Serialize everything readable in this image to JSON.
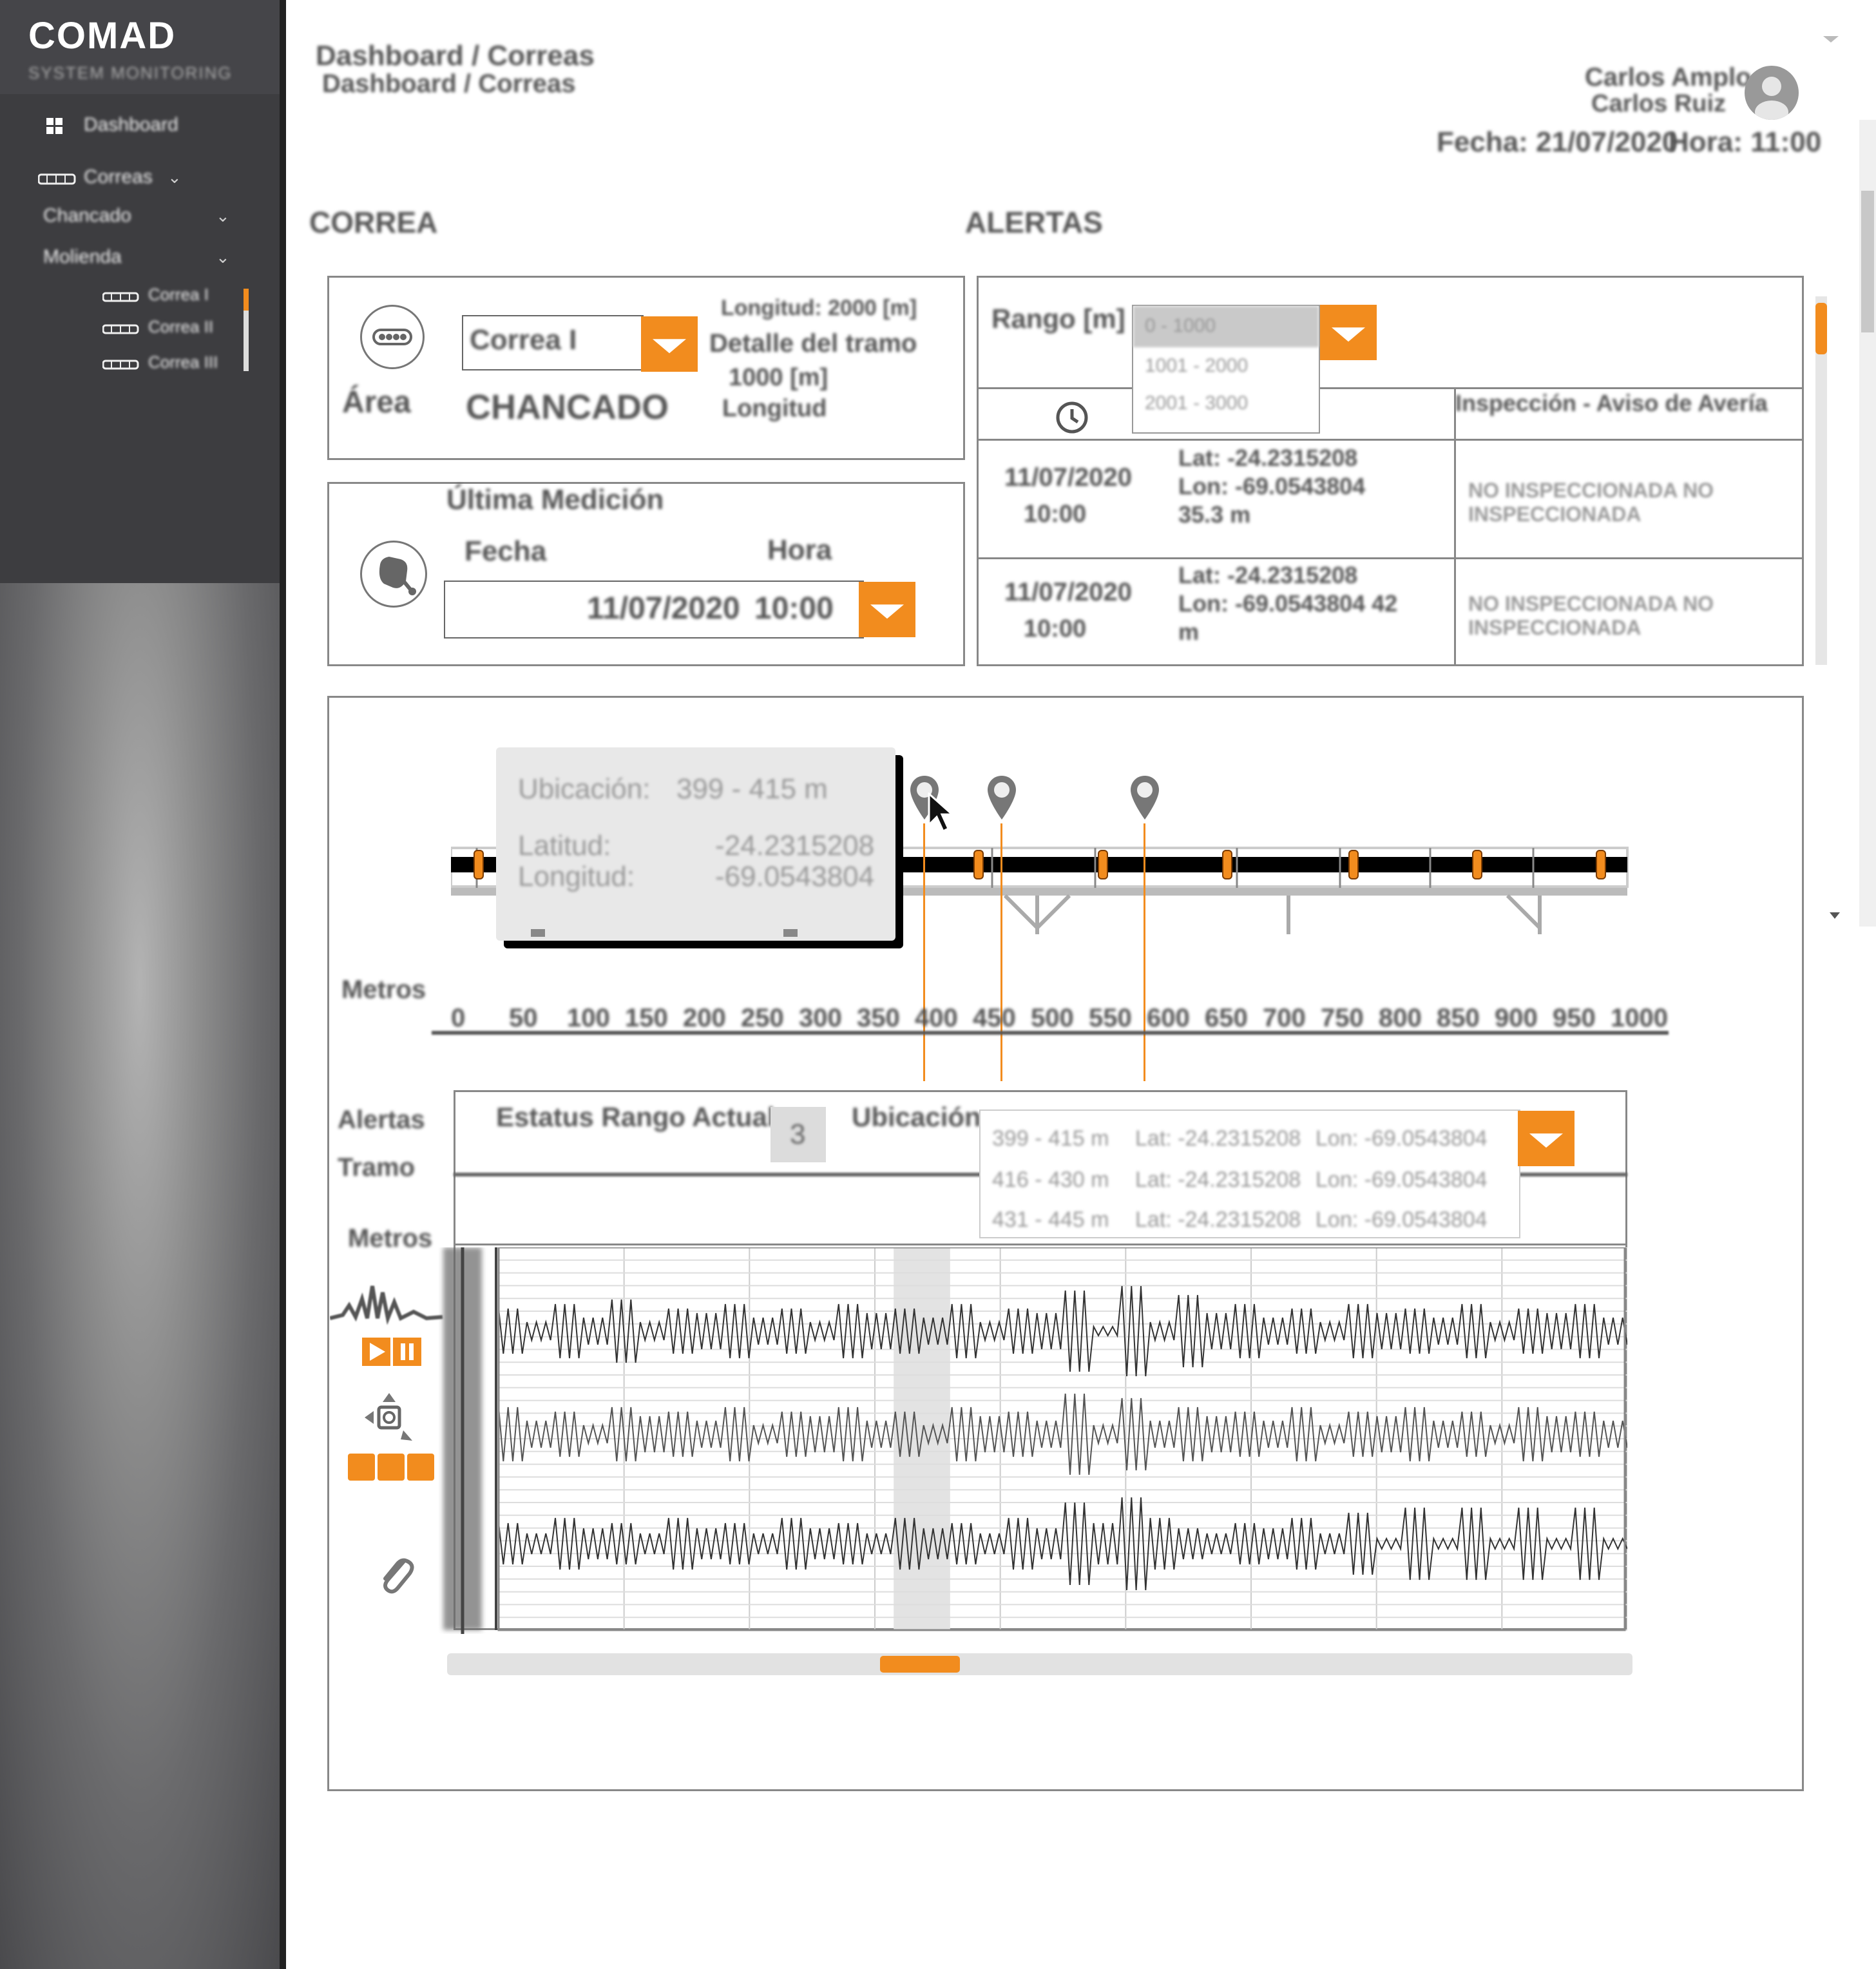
{
  "sidebar": {
    "logo": "COMAD",
    "subtitle": "SYSTEM MONITORING",
    "items": [
      {
        "label": "Dashboard"
      },
      {
        "label": "Correas"
      },
      {
        "label": "Chancado"
      },
      {
        "label": "Molienda"
      }
    ],
    "subitems": [
      {
        "label": "Correa I"
      },
      {
        "label": "Correa II"
      },
      {
        "label": "Correa III"
      }
    ]
  },
  "header": {
    "breadcrumb": "Dashboard / Correas",
    "breadcrumb_sub": "Dashboard / Correas",
    "user_name": "Carlos Amplo",
    "user_line2": "Carlos Ruiz",
    "date_label": "Fecha: 21/07/2020",
    "time_label": "Hora: 11:00"
  },
  "correa_section": {
    "title": "CORREA",
    "select_value": "Correa I",
    "area_label": "Área",
    "area_value": "CHANCADO",
    "longitud": "Longitud: 2000 [m]",
    "info_line2": "Detalle del tramo",
    "info_line3": "1000 [m]",
    "info_line4": "Longitud"
  },
  "medicion": {
    "title": "Última Medición",
    "col1": "Fecha",
    "col2": "Hora",
    "date_value": "11/07/2020",
    "time_value": "10:00"
  },
  "alertas": {
    "title": "ALERTAS",
    "rango_label": "Rango [m]",
    "rango_selected": "0 - 1000",
    "options": [
      "0 - 1000",
      "1001 - 2000",
      "2001 - 3000"
    ],
    "col_header": "Inspección - Aviso de Avería",
    "rows": [
      {
        "date": "11/07/2020",
        "time": "10:00",
        "detail": "Lat: -24.2315208 Lon: -69.0543804 35.3 m",
        "status": "NO INSPECCIONADA   NO INSPECCIONADA"
      },
      {
        "date": "11/07/2020",
        "time": "10:00",
        "detail": "Lat: -24.2315208 Lon: -69.0543804 42 m",
        "status": "NO INSPECCIONADA   NO INSPECCIONADA"
      }
    ]
  },
  "conveyor": {
    "tooltip_ubicacion_label": "Ubicación:",
    "tooltip_ubicacion_value": "399 - 415 m",
    "tooltip_lat_label": "Latitud:",
    "tooltip_lat_value": "-24.2315208",
    "tooltip_lon_label": "Longitud:",
    "tooltip_lon_value": "-69.0543804",
    "metros_label": "Metros",
    "ticks": [
      "0",
      "50",
      "100",
      "150",
      "200",
      "250",
      "300",
      "350",
      "400",
      "450",
      "500",
      "550",
      "600",
      "650",
      "700",
      "750",
      "800",
      "850",
      "900",
      "950",
      "1000"
    ]
  },
  "chart_panel": {
    "alertas_label": "Alertas",
    "tramo_label": "Tramo",
    "metros_label": "Metros",
    "estatus_label": "Estatus Rango Actual",
    "estatus_value": "3",
    "ubicacion_label": "Ubicación",
    "dropdown_rows": [
      {
        "range": "399 - 415 m",
        "lat": "Lat: -24.2315208",
        "lon": "Lon: -69.0543804"
      },
      {
        "range": "416 - 430 m",
        "lat": "Lat: -24.2315208",
        "lon": "Lon: -69.0543804"
      },
      {
        "range": "431 - 445 m",
        "lat": "Lat: -24.2315208",
        "lon": "Lon: -69.0543804"
      }
    ]
  },
  "chart_data": {
    "type": "line",
    "title": "",
    "xlabel": "",
    "ylabel": "",
    "grid": true,
    "highlight_x_range": [
      350,
      400
    ],
    "series": [
      {
        "values": [
          0.5,
          0.2,
          0.6,
          0.3,
          0.7,
          0.2,
          0.5,
          0.4,
          0.6,
          0.3,
          0.5,
          0.2,
          0.6,
          0.4,
          0.5,
          0.3,
          0.6,
          0.2,
          0.5,
          0.4,
          0.9,
          0.1,
          1.0,
          0.2,
          0.8,
          0.4,
          0.6,
          0.3,
          0.5,
          0.2,
          0.6,
          0.4,
          0.5,
          0.3,
          0.6,
          0.2,
          0.5,
          0.4,
          0.6,
          0.3
        ]
      },
      {
        "values": [
          0.6,
          0.3,
          0.5,
          0.2,
          0.6,
          0.4,
          0.5,
          0.3,
          0.6,
          0.2,
          0.5,
          0.4,
          0.6,
          0.3,
          0.5,
          0.2,
          0.6,
          0.4,
          0.5,
          0.3,
          0.9,
          0.2,
          0.8,
          0.3,
          0.6,
          0.4,
          0.5,
          0.3,
          0.6,
          0.2,
          0.5,
          0.4,
          0.6,
          0.3,
          0.5,
          0.2,
          0.6,
          0.4,
          0.5,
          0.3
        ]
      },
      {
        "values": [
          0.4,
          0.2,
          0.5,
          0.3,
          0.4,
          0.2,
          0.5,
          0.3,
          0.4,
          0.2,
          0.5,
          0.3,
          0.4,
          0.2,
          0.5,
          0.3,
          0.4,
          0.2,
          0.5,
          0.3,
          0.8,
          0.4,
          0.9,
          0.5,
          0.3,
          0.2,
          0.4,
          0.3,
          0.5,
          0.2,
          0.6,
          0.1,
          0.7,
          0.1,
          0.7,
          0.1,
          0.7,
          0.1,
          0.7,
          0.1
        ]
      }
    ]
  },
  "colors": {
    "accent": "#f28c1e",
    "sidebar_dark": "#3d3d40",
    "border": "#888888"
  }
}
